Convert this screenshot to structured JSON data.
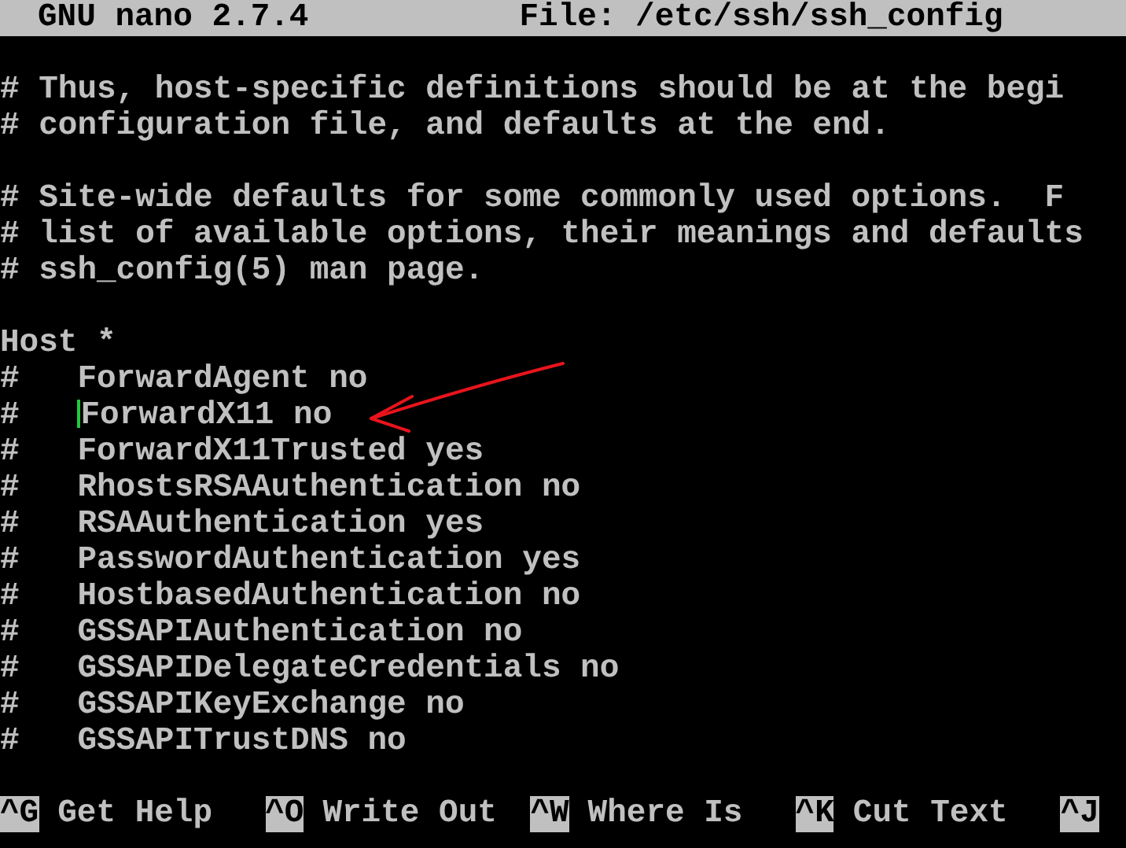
{
  "title_bar": {
    "app": "GNU nano 2.7.4",
    "file": "File: /etc/ssh/ssh_config"
  },
  "lines": [
    {
      "kind": "blank"
    },
    {
      "kind": "text",
      "text": "# Thus, host-specific definitions should be at the begi"
    },
    {
      "kind": "text",
      "text": "# configuration file, and defaults at the end."
    },
    {
      "kind": "blank"
    },
    {
      "kind": "text",
      "text": "# Site-wide defaults for some commonly used options.  F"
    },
    {
      "kind": "text",
      "text": "# list of available options, their meanings and defaults"
    },
    {
      "kind": "text",
      "text": "# ssh_config(5) man page."
    },
    {
      "kind": "blank"
    },
    {
      "kind": "text",
      "text": "Host *"
    },
    {
      "kind": "text",
      "text": "#   ForwardAgent no"
    },
    {
      "kind": "cursor",
      "before": "#   ",
      "after": "ForwardX11 no"
    },
    {
      "kind": "text",
      "text": "#   ForwardX11Trusted yes"
    },
    {
      "kind": "text",
      "text": "#   RhostsRSAAuthentication no"
    },
    {
      "kind": "text",
      "text": "#   RSAAuthentication yes"
    },
    {
      "kind": "text",
      "text": "#   PasswordAuthentication yes"
    },
    {
      "kind": "text",
      "text": "#   HostbasedAuthentication no"
    },
    {
      "kind": "text",
      "text": "#   GSSAPIAuthentication no"
    },
    {
      "kind": "text",
      "text": "#   GSSAPIDelegateCredentials no"
    },
    {
      "kind": "text",
      "text": "#   GSSAPIKeyExchange no"
    },
    {
      "kind": "text",
      "text": "#   GSSAPITrustDNS no"
    },
    {
      "kind": "blank"
    }
  ],
  "shortcuts": [
    [
      {
        "key": "^G",
        "label": "Get Help"
      },
      {
        "key": "^O",
        "label": "Write Out"
      },
      {
        "key": "^W",
        "label": "Where Is"
      },
      {
        "key": "^K",
        "label": "Cut Text"
      },
      {
        "key": "^J"
      }
    ]
  ]
}
